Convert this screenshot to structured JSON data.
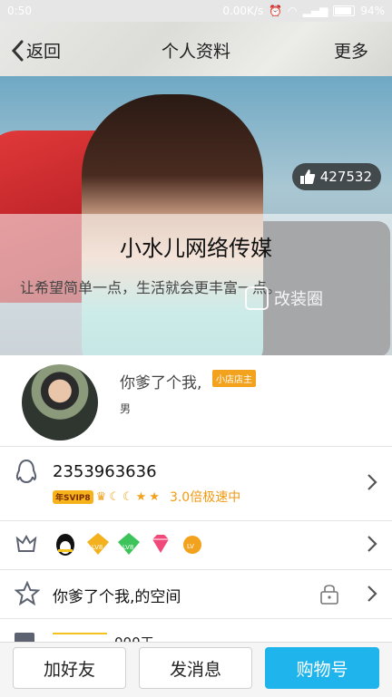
{
  "status_bar": {
    "time": "0:50",
    "speed": "0.00K/s",
    "battery": "94%"
  },
  "header": {
    "back_label": "返回",
    "title": "个人资料",
    "more_label": "更多"
  },
  "cover": {
    "like_count": "427532",
    "shop_name": "小水儿网络传媒",
    "motto": "让希望简单一点，生活就会更丰富一点。",
    "watermark": "改装圈"
  },
  "profile": {
    "nickname": "你爹了个我,",
    "badge": "小店店主",
    "gender": "男"
  },
  "qq": {
    "number": "2353963636",
    "vip_badge": "年SVIP8",
    "speed_text": "3.0倍极速中"
  },
  "space": {
    "label": "你爹了个我,的空间"
  },
  "partial_row": {
    "text": "000工"
  },
  "actions": {
    "add_friend": "加好友",
    "message": "发消息",
    "buy": "购物号"
  },
  "colors": {
    "accent": "#1fb5ec",
    "vip_orange": "#f29a12"
  }
}
